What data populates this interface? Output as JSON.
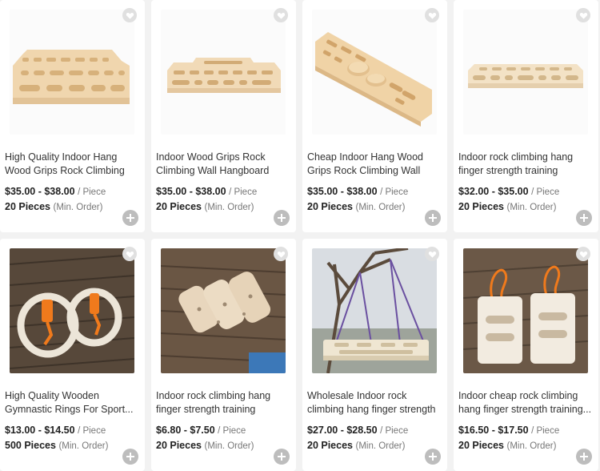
{
  "products": [
    {
      "title": "High Quality Indoor Hang Wood Grips Rock Climbing Wall...",
      "price": "$35.00 - $38.00",
      "price_unit": "/ Piece",
      "moq": "20 Pieces",
      "moq_unit": "(Min. Order)",
      "image": "hangboard-light"
    },
    {
      "title": "Indoor Wood Grips Rock Climbing Wall Hangboard",
      "price": "$35.00 - $38.00",
      "price_unit": "/ Piece",
      "moq": "20 Pieces",
      "moq_unit": "(Min. Order)",
      "image": "hangboard-slim"
    },
    {
      "title": "Cheap Indoor Hang Wood Grips Rock Climbing Wall Hangboard",
      "price": "$35.00 - $38.00",
      "price_unit": "/ Piece",
      "moq": "20 Pieces",
      "moq_unit": "(Min. Order)",
      "image": "hangboard-angled"
    },
    {
      "title": "Indoor rock climbing hang finger strength training beech...",
      "price": "$32.00 - $35.00",
      "price_unit": "/ Piece",
      "moq": "20 Pieces",
      "moq_unit": "(Min. Order)",
      "image": "hangboard-beech"
    },
    {
      "title": "High Quality Wooden Gymnastic Rings For Sport...",
      "price": "$13.00 - $14.50",
      "price_unit": "/ Piece",
      "moq": "500 Pieces",
      "moq_unit": "(Min. Order)",
      "image": "gym-rings"
    },
    {
      "title": "Indoor rock climbing hang finger strength training beech...",
      "price": "$6.80 - $7.50",
      "price_unit": "/ Piece",
      "moq": "20 Pieces",
      "moq_unit": "(Min. Order)",
      "image": "wood-holds"
    },
    {
      "title": "Wholesale Indoor rock climbing hang finger strength training...",
      "price": "$27.00 - $28.50",
      "price_unit": "/ Piece",
      "moq": "20 Pieces",
      "moq_unit": "(Min. Order)",
      "image": "hanging-board-tree"
    },
    {
      "title": "Indoor cheap rock climbing hang finger strength training...",
      "price": "$16.50 - $17.50",
      "price_unit": "/ Piece",
      "moq": "20 Pieces",
      "moq_unit": "(Min. Order)",
      "image": "portable-blocks"
    }
  ],
  "icons": {
    "favorite": "heart-icon",
    "add": "plus-icon"
  },
  "colors": {
    "wood": "#f0d6ae",
    "deck": "#5a4a3a",
    "price_text": "#222222",
    "muted": "#777777"
  }
}
